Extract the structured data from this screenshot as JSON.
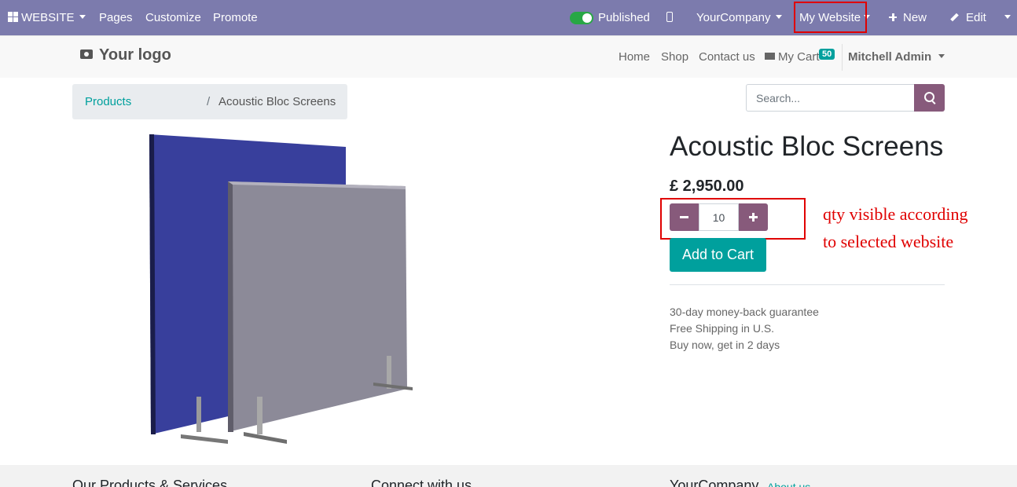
{
  "admin_bar": {
    "app_menu": "WEBSITE",
    "pages": "Pages",
    "customize": "Customize",
    "promote": "Promote",
    "published": "Published",
    "company": "YourCompany",
    "website": "My Website",
    "new": "New",
    "edit": "Edit",
    "background_color": "#7c7bad"
  },
  "header": {
    "logo": "Your logo",
    "nav": [
      "Home",
      "Shop",
      "Contact us"
    ],
    "cart_label": "My Cart",
    "cart_count": "50",
    "user": "Mitchell Admin"
  },
  "breadcrumb": {
    "parent": "Products",
    "separator": "/",
    "current": "Acoustic Bloc Screens"
  },
  "search": {
    "placeholder": "Search..."
  },
  "product": {
    "name": "Acoustic Bloc Screens",
    "price": "£ 2,950.00",
    "quantity": "10",
    "add_to_cart": "Add to Cart",
    "info": [
      "30-day money-back guarantee",
      "Free Shipping in U.S.",
      "Buy now, get in 2 days"
    ]
  },
  "annotation": [
    "qty visible according",
    "to selected website"
  ],
  "footer": {
    "col1_title": "Our Products & Services",
    "col2_title": "Connect with us",
    "col3_title": "YourCompany",
    "col3_link": "About us"
  },
  "colors": {
    "primary": "#875a7b",
    "accent": "#00a09d",
    "highlight": "#e00000"
  }
}
